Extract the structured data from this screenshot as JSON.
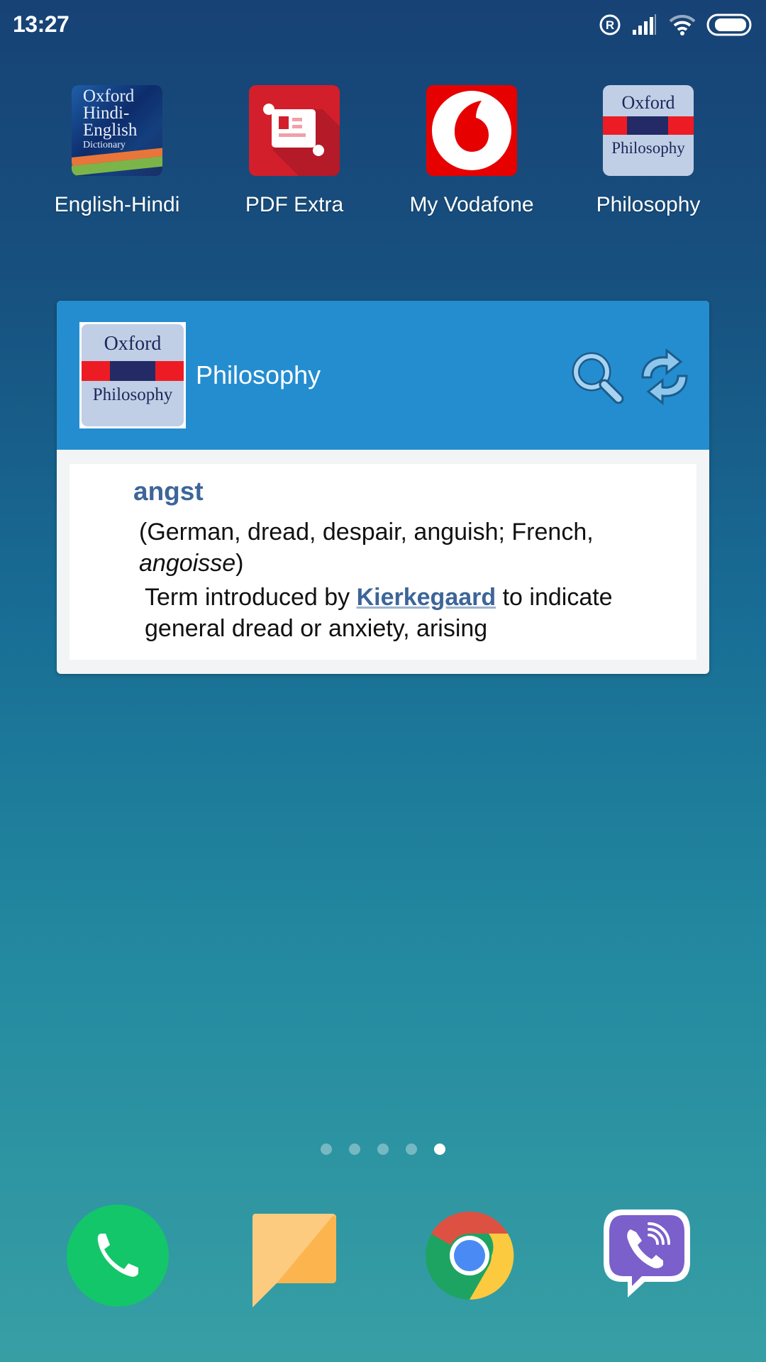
{
  "status_bar": {
    "time": "13:27",
    "icons": [
      "roaming-icon",
      "signal-icon",
      "wifi-icon",
      "battery-icon"
    ]
  },
  "home_apps": [
    {
      "label": "English-Hindi",
      "icon": "oxford-hindi-english-icon",
      "icon_text": [
        "Oxford",
        "Hindi-",
        "English",
        "Dictionary"
      ]
    },
    {
      "label": "PDF Extra",
      "icon": "pdf-extra-icon"
    },
    {
      "label": "My Vodafone",
      "icon": "vodafone-icon"
    },
    {
      "label": "Philosophy",
      "icon": "oxford-philosophy-icon",
      "icon_text": [
        "Oxford",
        "Philosophy"
      ]
    }
  ],
  "widget": {
    "logo_text": [
      "Oxford",
      "Philosophy"
    ],
    "title": "Philosophy",
    "search_icon": "search-icon",
    "refresh_icon": "refresh-icon",
    "entry": {
      "headword": "angst",
      "etymology_prefix": "(German, dread, despair, anguish; French, ",
      "etymology_italic": "angoisse",
      "etymology_suffix": ")",
      "definition_prefix": "Term introduced by ",
      "definition_link": "Kierkegaard",
      "definition_suffix": " to indicate general dread or anxiety, arising"
    },
    "colors": {
      "header": "#248dd0",
      "headword": "#3d6598"
    }
  },
  "page_indicator": {
    "total": 5,
    "active": 5
  },
  "dock": [
    {
      "name": "phone",
      "icon": "phone-icon"
    },
    {
      "name": "messages",
      "icon": "messages-icon"
    },
    {
      "name": "chrome",
      "icon": "chrome-icon"
    },
    {
      "name": "viber",
      "icon": "viber-icon"
    }
  ]
}
